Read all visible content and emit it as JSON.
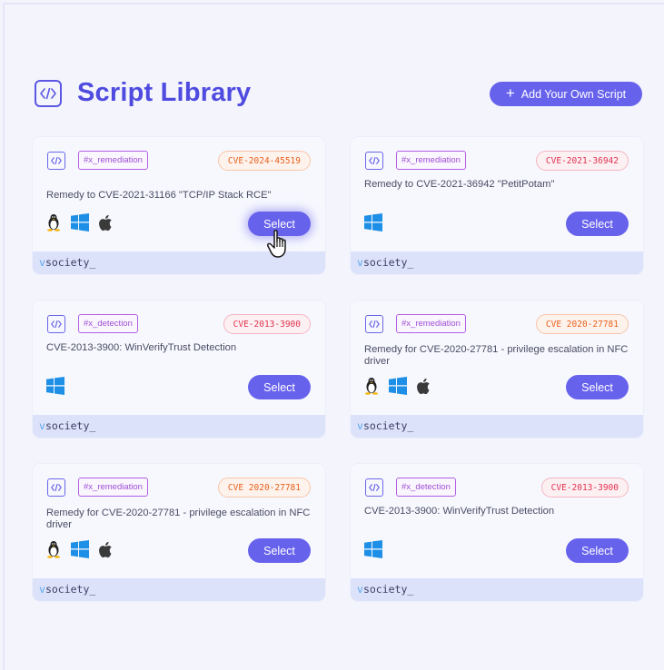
{
  "header": {
    "title": "Script Library",
    "add_button": "Add Your Own Script"
  },
  "colors": {
    "accent": "#6762ec",
    "title": "#4f4be0",
    "tag": "#9f4fd6",
    "cve_red": "#e0324f",
    "cve_orange": "#e8601e",
    "footer": "#dde2fb"
  },
  "brand": {
    "prefix": "v",
    "rest": "society_"
  },
  "cards": [
    {
      "tag": "#x_remediation",
      "cve": "CVE-2024-45519",
      "cve_color": "orange",
      "description": "Remedy to CVE-2021-31166 \"TCP/IP Stack RCE\"",
      "os": [
        "linux-icon",
        "windows-icon",
        "apple-icon"
      ],
      "button": "Select"
    },
    {
      "tag": "#x_remediation",
      "cve": "CVE-2021-36942",
      "cve_color": "red",
      "description": "Remedy to CVE-2021-36942 \"PetitPotam\"",
      "os": [
        "windows-icon"
      ],
      "button": "Select"
    },
    {
      "tag": "#x_detection",
      "cve": "CVE-2013-3900",
      "cve_color": "red",
      "description": "CVE-2013-3900: WinVerifyTrust Detection",
      "os": [
        "windows-icon"
      ],
      "button": "Select"
    },
    {
      "tag": "#x_remediation",
      "cve": "CVE 2020-27781",
      "cve_color": "orange",
      "description": "Remedy for CVE-2020-27781 - privilege escalation in NFC driver",
      "os": [
        "linux-icon",
        "windows-icon",
        "apple-icon"
      ],
      "button": "Select"
    },
    {
      "tag": "#x_remediation",
      "cve": "CVE 2020-27781",
      "cve_color": "orange",
      "description": "Remedy for CVE-2020-27781 - privilege escalation in NFC driver",
      "os": [
        "linux-icon",
        "windows-icon",
        "apple-icon"
      ],
      "button": "Select"
    },
    {
      "tag": "#x_detection",
      "cve": "CVE-2013-3900",
      "cve_color": "red",
      "description": "CVE-2013-3900: WinVerifyTrust Detection",
      "os": [
        "windows-icon"
      ],
      "button": "Select"
    }
  ]
}
